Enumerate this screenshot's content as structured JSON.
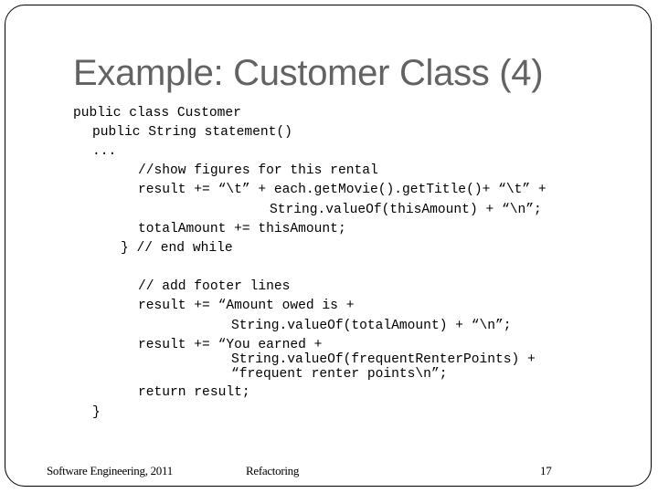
{
  "slide": {
    "title": "Example: Customer Class (4)",
    "code_lines": [
      "public class Customer",
      "public String statement()",
      "...",
      "//show figures for this rental",
      "result += “\\t” + each.getMovie().getTitle()+ “\\t” +",
      "String.valueOf(thisAmount) + “\\n”;",
      "totalAmount += thisAmount;",
      "} // end while",
      "// add footer lines",
      "result += “Amount owed is +",
      "String.valueOf(totalAmount) + “\\n”;",
      "result += “You earned +",
      "String.valueOf(frequentRenterPoints) +",
      "“frequent renter points\\n”;",
      "return result;",
      "}"
    ]
  },
  "footer": {
    "course": "Software Engineering, 2011",
    "topic": "Refactoring",
    "page_number": "17"
  }
}
